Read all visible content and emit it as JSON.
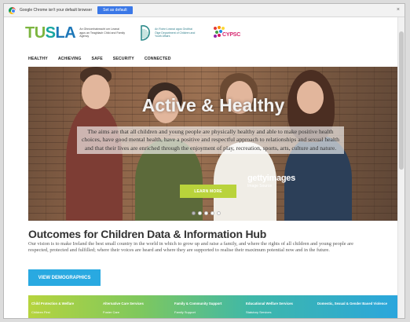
{
  "infobar": {
    "message": "Google Chrome isn't your default browser",
    "button": "Set as default",
    "close": "×"
  },
  "header": {
    "tusla_logo": {
      "t1": "TU",
      "t2": "S",
      "t3": "LA",
      "tagline": "An Ghníomhaireacht um Leanaí agus an Teaghlach Child and Family Agency"
    },
    "dept_logo": {
      "text": "An Roinn Leanaí agus Gnóthaí Óige Department of Children and Youth Affairs"
    },
    "cypsc_logo": {
      "text": "CYPSC"
    }
  },
  "nav": [
    "HEALTHY",
    "ACHIEVING",
    "SAFE",
    "SECURITY",
    "CONNECTED"
  ],
  "hero": {
    "title": "Active & Healthy",
    "body": "The aims are that all children and young people are physically healthy and able to make positive health choices, have good mental health, have a positive and respectful approach to relationships and sexual health and that their lives are enriched through the enjoyment of play, recreation, sports, arts, culture and nature.",
    "watermark": "gettyimages",
    "watermark_sub": "Image Source",
    "button": "LEARN MORE",
    "slides_total": 5,
    "slide_active": 1
  },
  "outcomes": {
    "title": "Outcomes for Children Data & Information Hub",
    "body": "Our vision is to make Ireland the best small country in the world in which to grow up and raise a family, and where the rights of all children and young people are respected, protected and fulfilled; where their voices are heard and where they are supported to realise their maximum potential now and in the future.",
    "button": "VIEW DEMOGRAPHICS"
  },
  "band": [
    {
      "head": "Child Protection & Welfare",
      "item": "Children First"
    },
    {
      "head": "Alternative Care Services",
      "item": "Foster Care"
    },
    {
      "head": "Family & Community Support",
      "item": "Family Support"
    },
    {
      "head": "Educational Welfare Services",
      "item": "Statutory Services"
    },
    {
      "head": "Domestic, Sexual & Gender Based Violence",
      "item": ""
    }
  ],
  "colors": {
    "accent_green": "#b9d33b",
    "accent_blue": "#29a9e1",
    "infobar_button": "#3b78e7"
  }
}
